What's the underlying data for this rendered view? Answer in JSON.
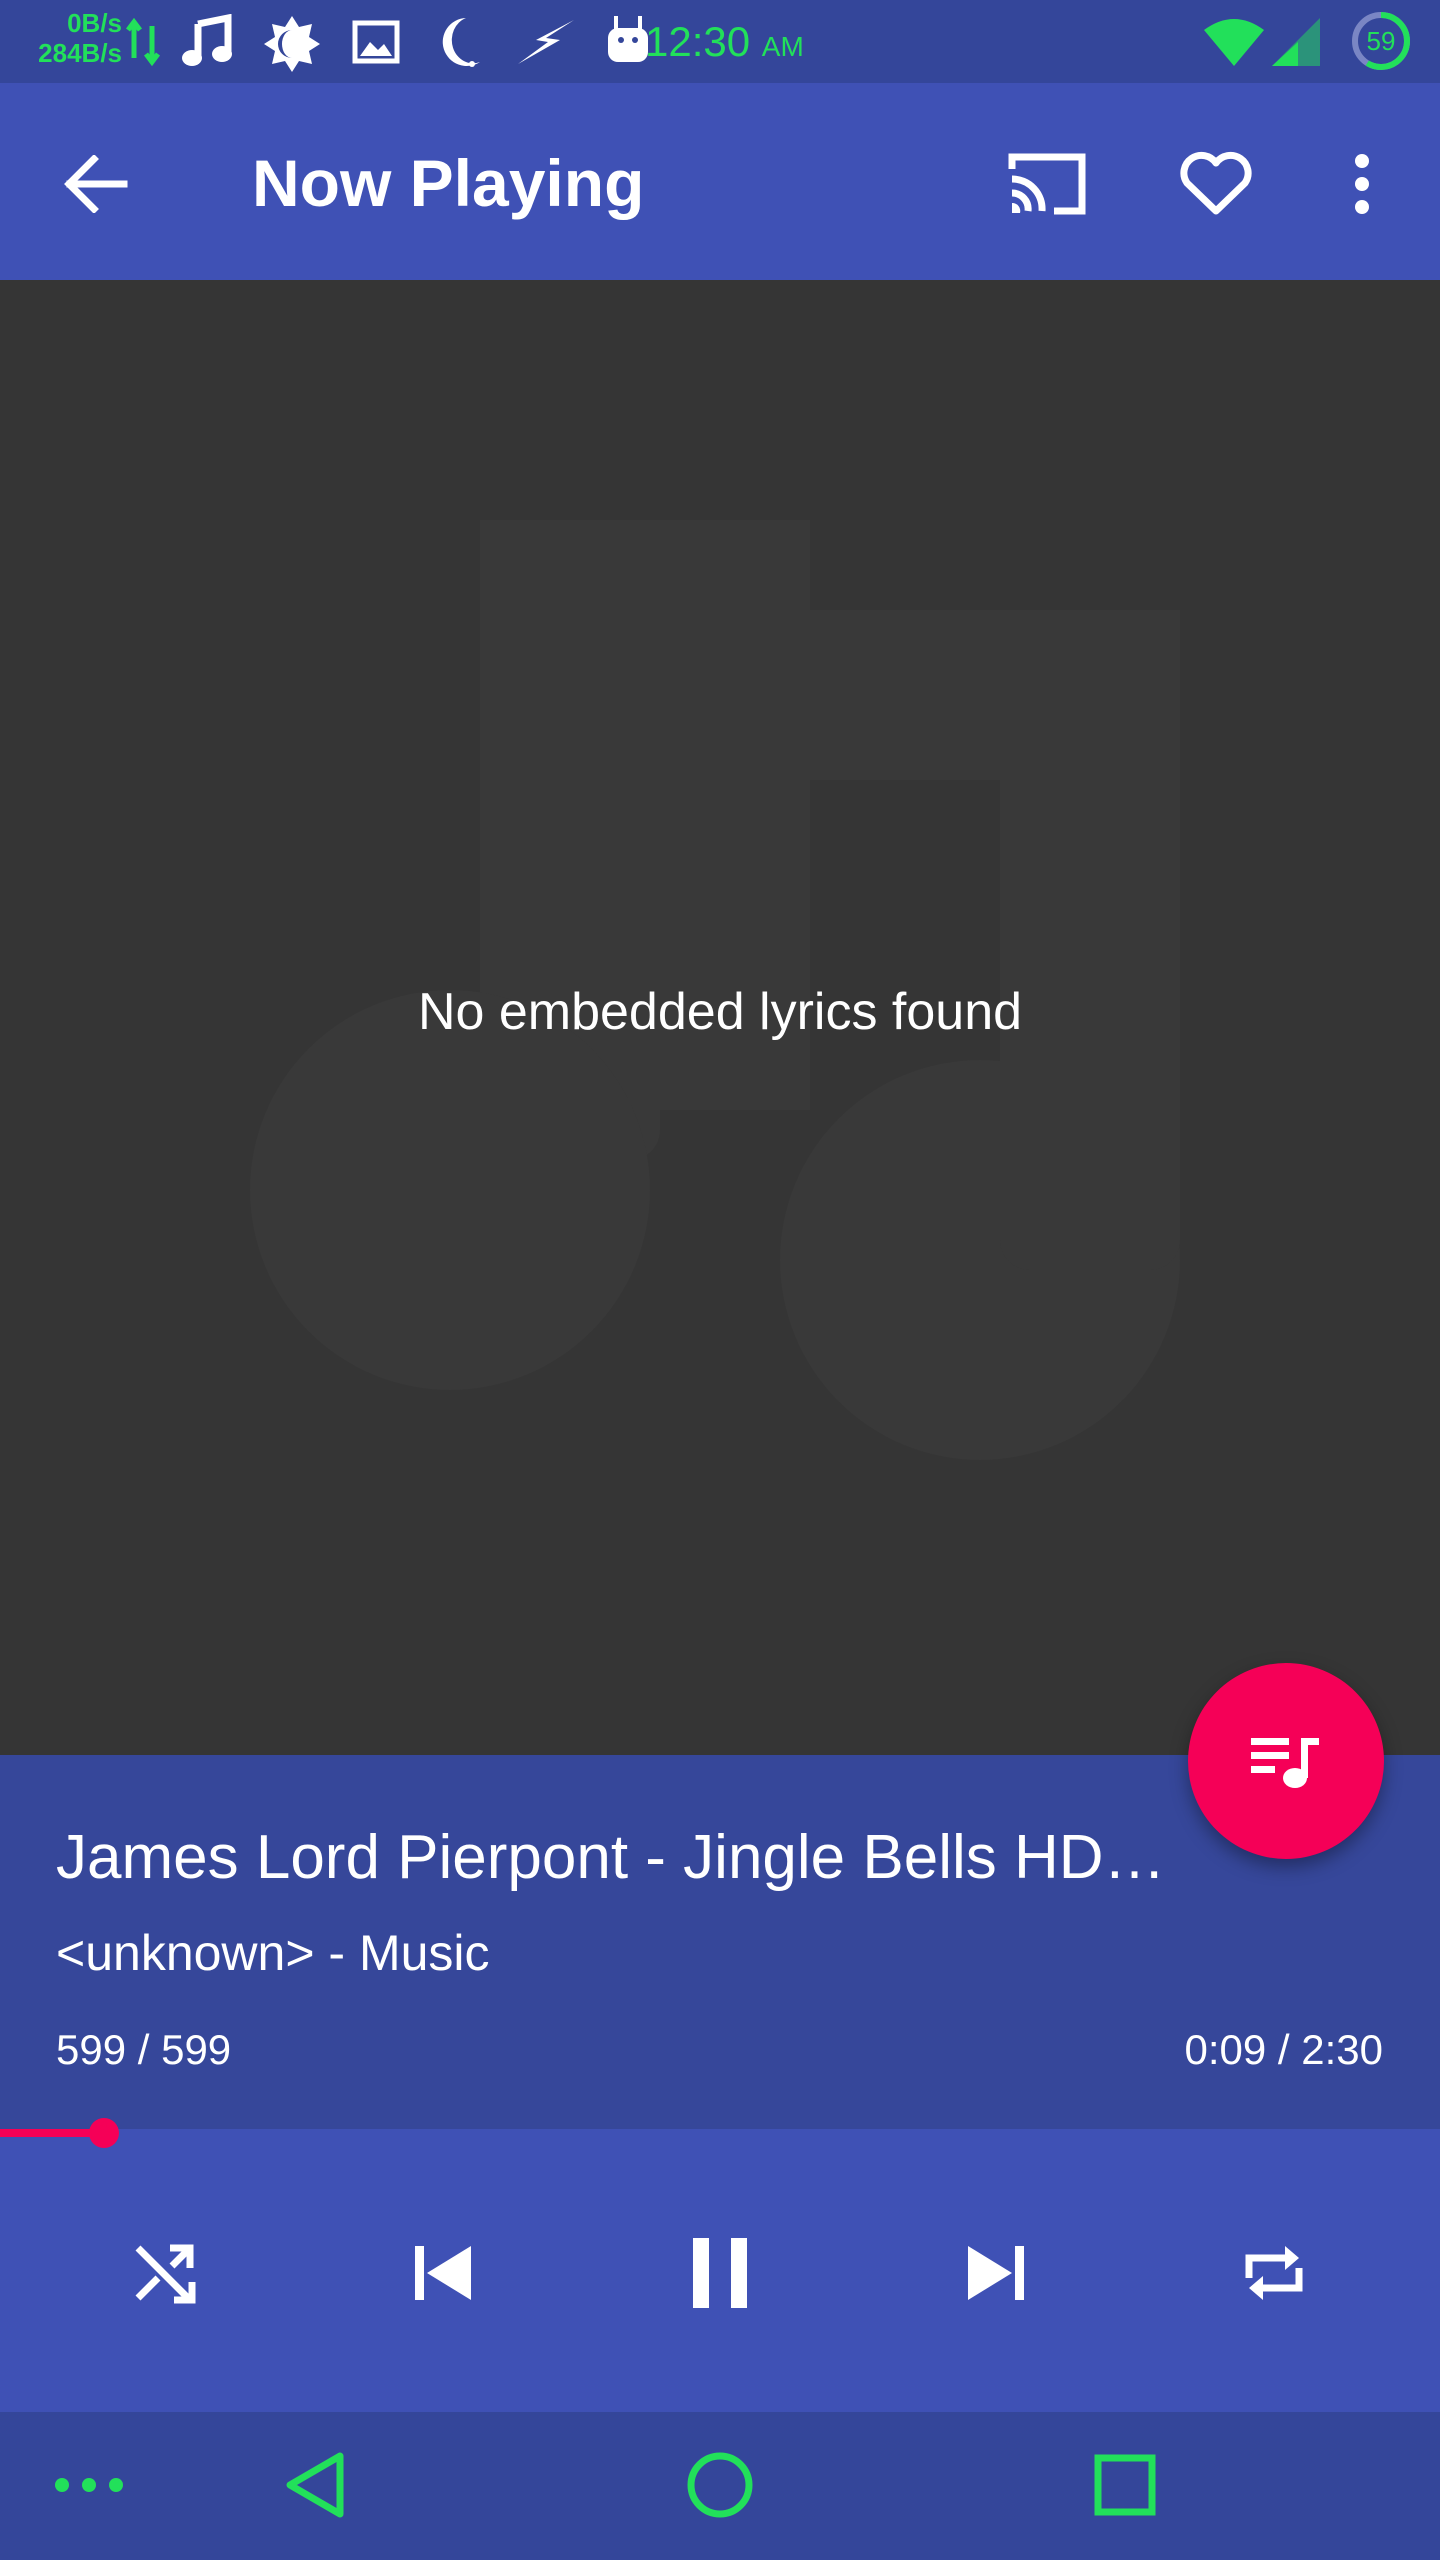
{
  "status_bar": {
    "net_up": "0B/s",
    "net_down": "284B/s",
    "time": "12:30",
    "ampm": "AM",
    "battery_level": "59",
    "accent_color": "#22e05a",
    "icons": [
      "data-arrows-icon",
      "music-note-icon",
      "brightness-icon",
      "image-icon",
      "moon-icon",
      "flash-icon",
      "android-icon",
      "wifi-icon",
      "cell-signal-icon",
      "battery-circle-icon"
    ]
  },
  "app_bar": {
    "title": "Now Playing",
    "back_icon": "arrow-back-icon",
    "cast_icon": "cast-icon",
    "favorite_icon": "heart-outline-icon",
    "more_icon": "more-vert-icon",
    "color": "#3f51b5"
  },
  "lyrics": {
    "message": "No embedded lyrics found",
    "background_icon": "music-note-watermark-icon"
  },
  "track": {
    "title": "James Lord Pierpont - Jingle Bells HD…",
    "subtitle": "<unknown> - Music",
    "queue_position": "599 / 599",
    "time": "0:09 / 2:30",
    "progress_fraction": 0.06,
    "accent_color": "#f50057"
  },
  "controls": {
    "shuffle": "shuffle-icon",
    "previous": "skip-previous-icon",
    "play_pause": "pause-icon",
    "next": "skip-next-icon",
    "repeat": "repeat-icon"
  },
  "fab": {
    "icon": "queue-music-icon"
  },
  "nav_bar": {
    "menu": "more-horiz-icon",
    "back": "nav-back-icon",
    "home": "nav-home-icon",
    "recents": "nav-recents-icon",
    "color": "#22e05a"
  }
}
